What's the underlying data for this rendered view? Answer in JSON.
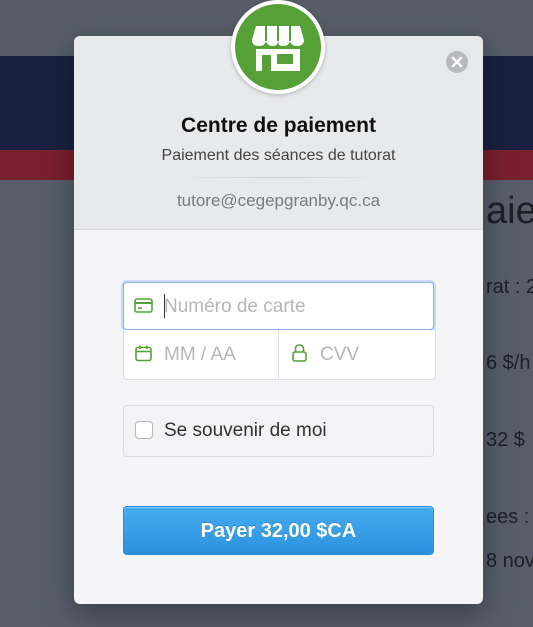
{
  "background_page": {
    "heading_fragment": "aie",
    "line1": "rat : 2",
    "line2": "6 $/h",
    "line3": "32 $",
    "line4": "ees :",
    "line5": "8 nov"
  },
  "modal": {
    "title": "Centre de paiement",
    "subtitle": "Paiement des séances de tutorat",
    "email": "tutore@cegepgranby.qc.ca",
    "logo_icon": "store-icon",
    "close_icon": "close-icon"
  },
  "form": {
    "card_number": {
      "placeholder": "Numéro de carte",
      "value": "",
      "icon": "credit-card-icon"
    },
    "expiry": {
      "placeholder": "MM / AA",
      "value": "",
      "icon": "calendar-icon"
    },
    "cvv": {
      "placeholder": "CVV",
      "value": "",
      "icon": "lock-icon"
    },
    "remember_me": {
      "label": "Se souvenir de moi",
      "checked": false
    },
    "pay_button_label": "Payer 32,00 $CA"
  },
  "colors": {
    "brand_green": "#56a038",
    "button_blue": "#2b91de",
    "focus_blue": "#8fb4e6"
  }
}
